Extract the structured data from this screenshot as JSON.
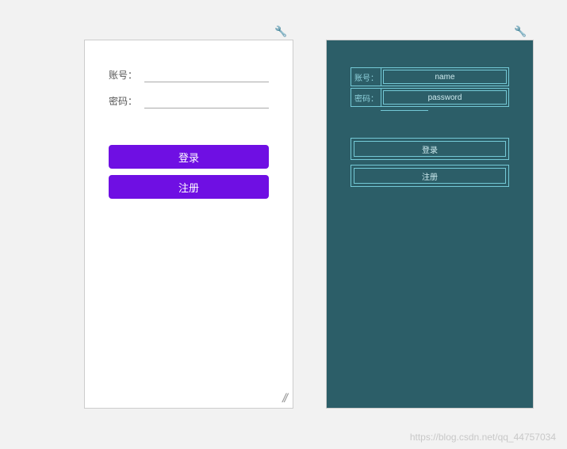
{
  "left": {
    "username_label": "账号：",
    "password_label": "密码：",
    "login_label": "登录",
    "register_label": "注册"
  },
  "right": {
    "username_label": "账号：",
    "password_label": "密码：",
    "username_field": "name",
    "password_field": "password",
    "login_label": "登录",
    "register_label": "注册"
  },
  "watermark": "https://blog.csdn.net/qq_44757034"
}
